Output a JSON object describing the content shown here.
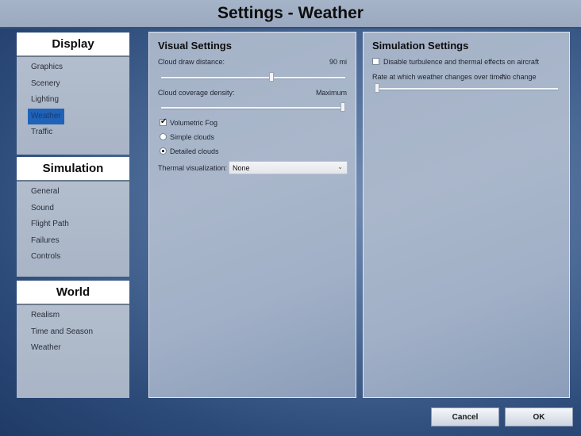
{
  "window": {
    "title": "Settings - Weather"
  },
  "sidebar": {
    "categories": [
      {
        "header": "Display",
        "items": [
          "Graphics",
          "Scenery",
          "Lighting",
          "Weather",
          "Traffic"
        ],
        "active": "Weather"
      },
      {
        "header": "Simulation",
        "items": [
          "General",
          "Sound",
          "Flight Path",
          "Failures",
          "Controls"
        ]
      },
      {
        "header": "World",
        "items": [
          "Realism",
          "Time and Season",
          "Weather"
        ]
      }
    ]
  },
  "visual": {
    "title": "Visual Settings",
    "cloud_draw_distance": {
      "label": "Cloud draw distance:",
      "value": "90 mi",
      "fraction": 0.6
    },
    "cloud_coverage": {
      "label": "Cloud coverage density:",
      "value": "Maximum",
      "fraction": 1.0
    },
    "volumetric_fog": {
      "label": "Volumetric Fog",
      "checked": true
    },
    "simple_clouds": {
      "label": "Simple clouds",
      "selected": false
    },
    "detailed_clouds": {
      "label": "Detailed clouds",
      "selected": true
    },
    "thermal": {
      "label": "Thermal visualization:",
      "value": "None"
    }
  },
  "simulation": {
    "title": "Simulation Settings",
    "disable_turbulence": {
      "label": "Disable turbulence and thermal effects on aircraft",
      "checked": false
    },
    "weather_rate": {
      "label": "Rate at which weather changes over time:",
      "value": "No change",
      "fraction": 0.0
    }
  },
  "footer": {
    "cancel_label": "Cancel",
    "ok_label": "OK"
  },
  "icons": {
    "check": "✔",
    "chevron": "⌄"
  }
}
